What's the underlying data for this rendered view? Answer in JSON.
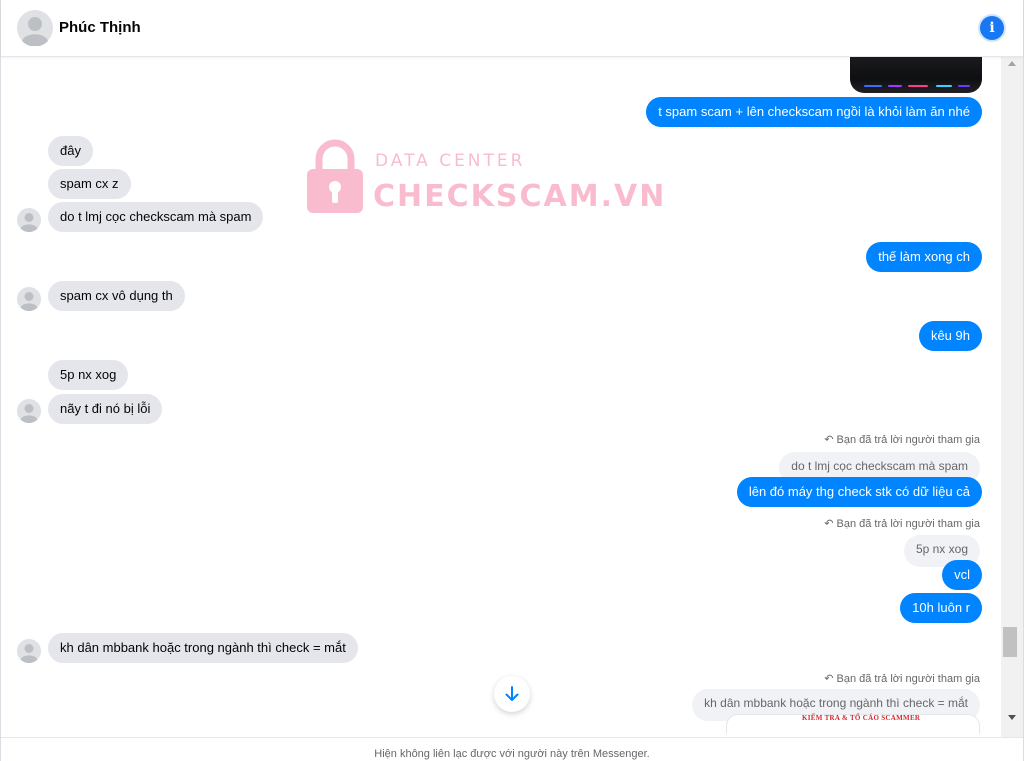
{
  "header": {
    "contact_name": "Phúc Thịnh",
    "info_icon": "i"
  },
  "watermark": {
    "line1": "DATA CENTER",
    "line2": "CHECKSCAM.VN"
  },
  "messages": {
    "m1": "t spam scam + lên checkscam ngồi là khỏi làm ăn nhé",
    "m2": "đây",
    "m3": "spam cx z",
    "m4": "do t lmj cọc checkscam mà spam",
    "m5": "thế làm xong ch",
    "m6": "spam cx vô dụng th",
    "m7": "kêu 9h",
    "m8": "5p nx xog",
    "m9": "nãy t đi nó bị lỗi",
    "r1_note": "Bạn đã trả lời người tham gia",
    "r1_quote": "do t lmj cọc checkscam mà spam",
    "m10": "lên đó máy thg check stk có dữ liệu cả",
    "r2_note": "Bạn đã trả lời người tham gia",
    "r2_quote": "5p nx xog",
    "m11": "vcl",
    "m12": "10h luôn r",
    "m13": "kh dân mbbank hoặc trong ngành thì check = mắt",
    "r3_note": "Bạn đã trả lời người tham gia",
    "r3_quote": "kh dân mbbank hoặc trong ngành thì check = mắt"
  },
  "stamp_text": "KIỂM TRA & TỐ CÁO SCAMMER",
  "footer": {
    "notice": "Hiện không liên lạc được với người này trên Messenger."
  },
  "colors": {
    "outgoing_bubble": "#0084ff",
    "incoming_bubble": "#e4e6eb",
    "watermark": "#f26b93",
    "accent": "#1877f2"
  }
}
